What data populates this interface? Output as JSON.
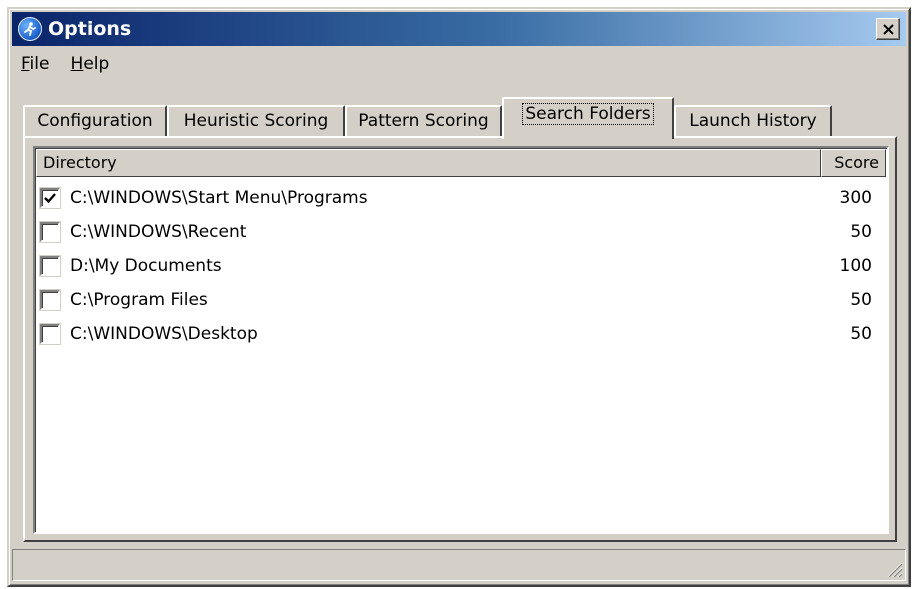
{
  "window": {
    "title": "Options",
    "app_icon": "runner-app-icon",
    "close_icon": "close-icon"
  },
  "menu": [
    {
      "mnemonic": "F",
      "rest": "ile"
    },
    {
      "mnemonic": "H",
      "rest": "elp"
    }
  ],
  "tabs": [
    {
      "label": "Configuration",
      "active": false
    },
    {
      "label": "Heuristic Scoring",
      "active": false
    },
    {
      "label": "Pattern Scoring",
      "active": false
    },
    {
      "label": "Search Folders",
      "active": true
    },
    {
      "label": "Launch History",
      "active": false
    }
  ],
  "list": {
    "columns": {
      "directory": "Directory",
      "score": "Score"
    },
    "rows": [
      {
        "checked": true,
        "directory": "C:\\WINDOWS\\Start Menu\\Programs",
        "score": "300"
      },
      {
        "checked": false,
        "directory": "C:\\WINDOWS\\Recent",
        "score": "50"
      },
      {
        "checked": false,
        "directory": "D:\\My Documents",
        "score": "100"
      },
      {
        "checked": false,
        "directory": "C:\\Program Files",
        "score": "50"
      },
      {
        "checked": false,
        "directory": "C:\\WINDOWS\\Desktop",
        "score": "50"
      }
    ]
  },
  "status": {
    "text": ""
  }
}
